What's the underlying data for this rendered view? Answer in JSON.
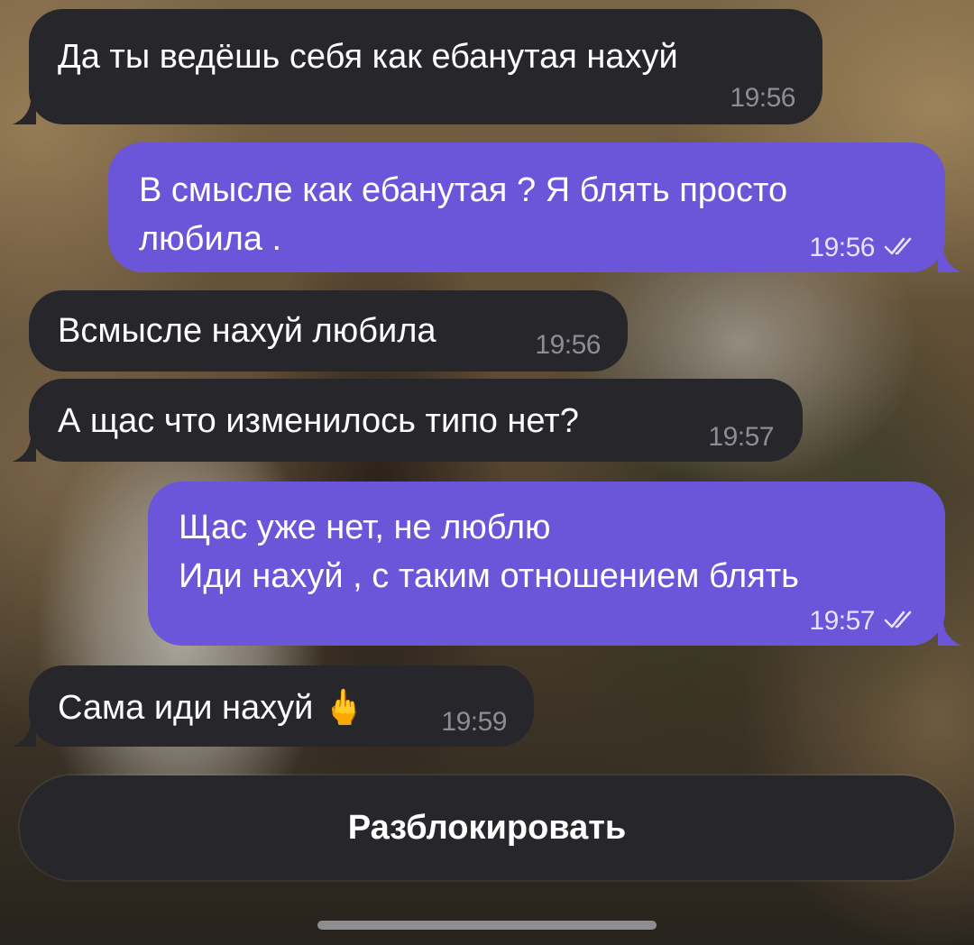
{
  "messages": [
    {
      "direction": "incoming",
      "text": "Да ты ведёшь себя как ебанутая нахуй",
      "time": "19:56"
    },
    {
      "direction": "outgoing",
      "text": "В смысле как ебанутая ? Я блять просто\nлюбила .",
      "time": "19:56",
      "status": "read"
    },
    {
      "direction": "incoming",
      "text": "Всмысле нахуй любила",
      "time": "19:56"
    },
    {
      "direction": "incoming",
      "text": "А щас что изменилось типо нет?",
      "time": "19:57"
    },
    {
      "direction": "outgoing",
      "text": "Щас уже нет, не люблю\nИди нахуй , с таким отношением блять",
      "time": "19:57",
      "status": "read"
    },
    {
      "direction": "incoming",
      "text": "Сама иди нахуй 🖕",
      "time": "19:59"
    }
  ],
  "unblock_button": {
    "label": "Разблокировать"
  },
  "colors": {
    "incoming_bubble": "#26262b",
    "outgoing_bubble": "#6b55d9",
    "incoming_time": "#8d8d96",
    "outgoing_time": "#e7e2ff"
  }
}
